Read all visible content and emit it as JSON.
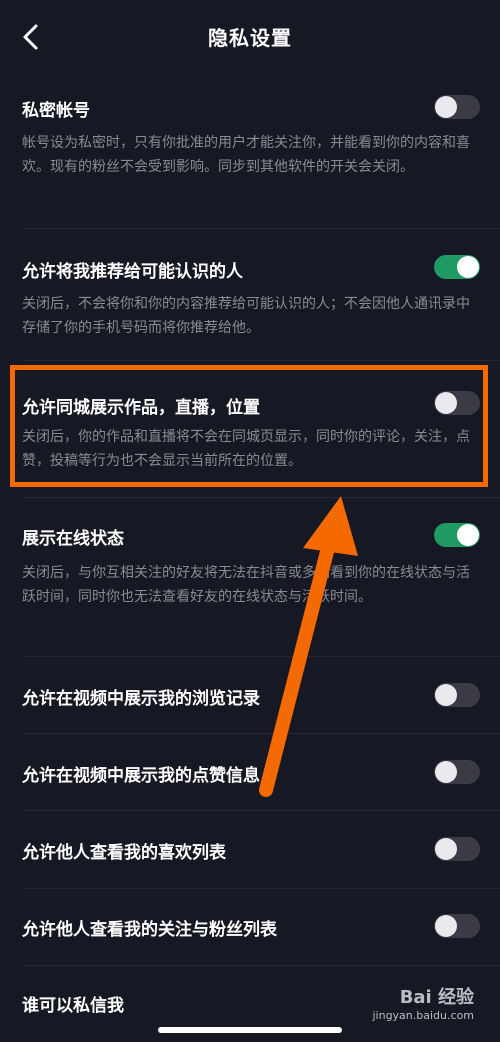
{
  "header": {
    "title": "隐私设置",
    "back_icon": "chevron-left-icon"
  },
  "items": [
    {
      "label": "私密帐号",
      "desc": "帐号设为私密时，只有你批准的用户才能关注你，并能看到你的内容和喜欢。现有的粉丝不会受到影响。同步到其他软件的开关会关闭。",
      "on": false
    },
    {
      "label": "允许将我推荐给可能认识的人",
      "desc": "关闭后，不会将你和你的内容推荐给可能认识的人；不会因他人通讯录中存储了你的手机号码而将你推荐给他。",
      "on": true
    },
    {
      "label": "允许同城展示作品，直播，位置",
      "desc": "关闭后，你的作品和直播将不会在同城页显示，同时你的评论，关注，点赞，投稿等行为也不会显示当前所在的位置。",
      "on": false
    },
    {
      "label": "展示在线状态",
      "desc": "关闭后，与你互相关注的好友将无法在抖音或多闪看到你的在线状态与活跃时间，同时你也无法查看好友的在线状态与活跃时间。",
      "on": true
    },
    {
      "label": "允许在视频中展示我的浏览记录",
      "on": false
    },
    {
      "label": "允许在视频中展示我的点赞信息",
      "on": false
    },
    {
      "label": "允许他人查看我的喜欢列表",
      "on": false
    },
    {
      "label": "允许他人查看我的关注与粉丝列表",
      "on": false
    },
    {
      "label": "谁可以私信我"
    }
  ],
  "colors": {
    "background": "#161823",
    "toggle_on": "#1f9a63",
    "highlight": "#f56a00"
  },
  "watermark": {
    "logo": "Bai 经验",
    "url": "jingyan.baidu.com"
  }
}
